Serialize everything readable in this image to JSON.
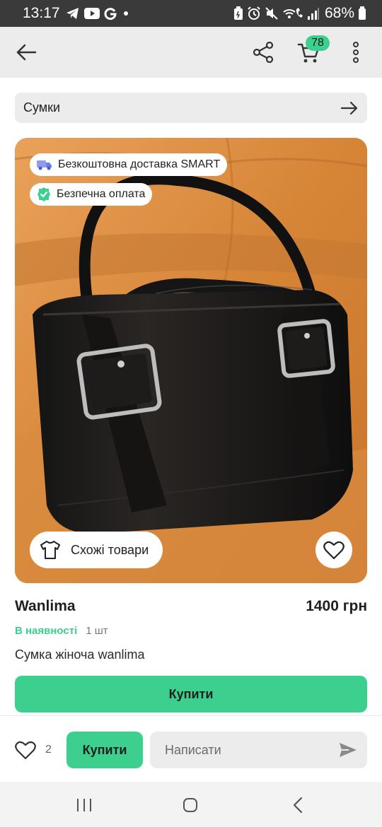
{
  "status_bar": {
    "time": "13:17",
    "left_icons": [
      "telegram-icon",
      "youtube-icon",
      "google-icon",
      "dot-icon"
    ],
    "right_icons": [
      "battery-saver-icon",
      "alarm-icon",
      "mute-icon",
      "wifi-call-icon",
      "signal-icon"
    ],
    "battery": "68%"
  },
  "app_bar": {
    "back_icon": "arrow-left-icon",
    "share_icon": "share-icon",
    "cart_icon": "cart-icon",
    "cart_count": "78",
    "menu_icon": "more-vertical-icon"
  },
  "category": {
    "label": "Сумки",
    "arrow_icon": "arrow-right-icon"
  },
  "photo": {
    "badges": [
      {
        "icon": "truck-icon",
        "label": "Безкоштовна доставка SMART"
      },
      {
        "icon": "shield-check-icon",
        "label": "Безпечна оплата"
      }
    ],
    "similar_label": "Схожі товари",
    "similar_icon": "tshirt-icon",
    "favorite_icon": "heart-icon"
  },
  "product": {
    "name": "Wanlima",
    "price": "1400 грн",
    "stock_status": "В наявності",
    "stock_qty": "1 шт",
    "description": "Сумка жіноча wanlima",
    "buy_label": "Купити"
  },
  "action_bar": {
    "like_icon": "heart-icon",
    "like_count": "2",
    "buy_label": "Купити",
    "message_placeholder": "Написати",
    "send_icon": "send-icon"
  },
  "nav_bar": {
    "recents_icon": "recents-icon",
    "home_icon": "home-icon",
    "back_icon": "back-chevron-icon"
  },
  "colors": {
    "accent": "#3dcf8e",
    "status_bar": "#3a3a3a",
    "app_bar": "#ececec"
  }
}
